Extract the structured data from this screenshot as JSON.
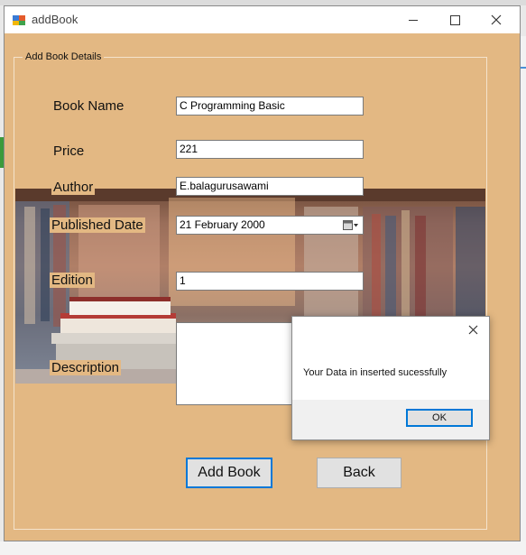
{
  "window": {
    "title": "addBook",
    "group_label": "Add Book Details"
  },
  "form": {
    "book_name_label": "Book Name",
    "book_name_value": "C Programming Basic",
    "price_label": "Price",
    "price_value": "221",
    "author_label": "Author",
    "author_value": "E.balagurusawami",
    "published_date_label": "Published Date",
    "published_date_value": "21  February  2000",
    "edition_label": "Edition",
    "edition_value": "1",
    "description_label": "Description",
    "description_value": ""
  },
  "buttons": {
    "add_book": "Add Book",
    "back": "Back"
  },
  "message_box": {
    "text": "Your Data in inserted sucessfully",
    "ok": "OK"
  },
  "colors": {
    "form_background": "#e3b883",
    "accent": "#0078d7"
  },
  "icons": {
    "app": "app-icon",
    "minimize": "minimize-icon",
    "maximize": "maximize-icon",
    "close": "close-icon",
    "calendar": "calendar-dropdown-icon",
    "dialog_close": "close-icon"
  }
}
